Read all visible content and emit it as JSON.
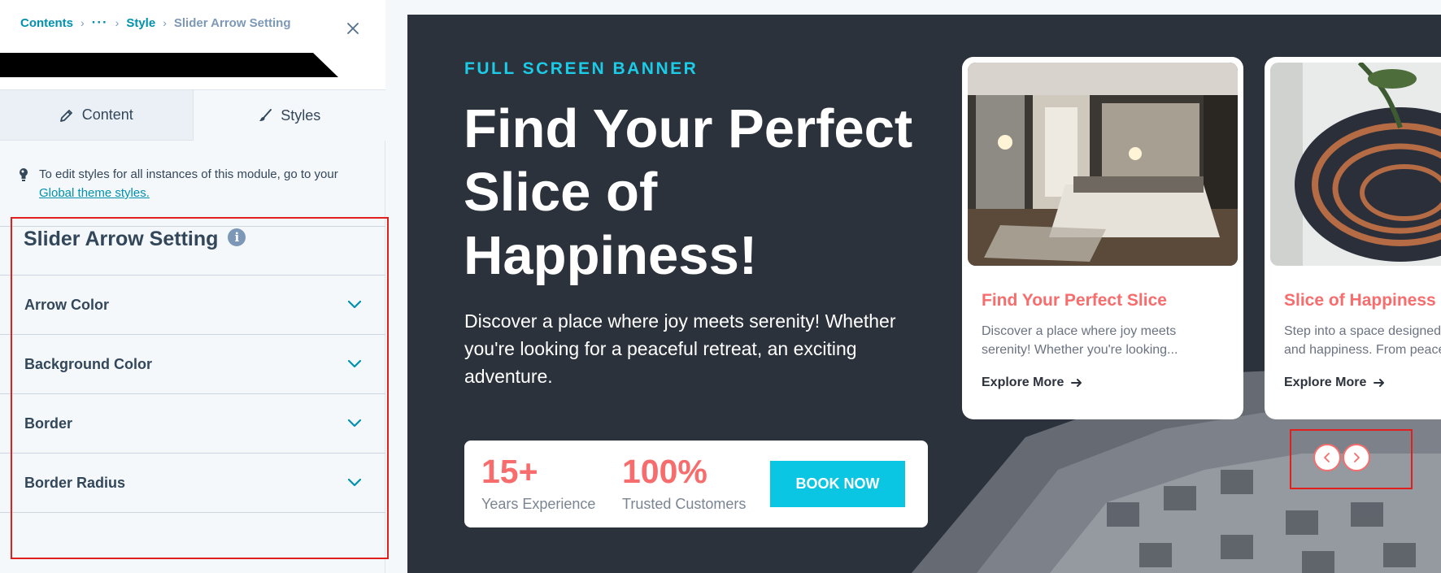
{
  "breadcrumb": {
    "root": "Contents",
    "ellipsis": "···",
    "parent": "Style",
    "current": "Slider Arrow Setting"
  },
  "tabs": [
    {
      "label": "Content",
      "icon": "pencil-icon",
      "active": false
    },
    {
      "label": "Styles",
      "icon": "brush-icon",
      "active": true
    }
  ],
  "note": {
    "text": "To edit styles for all instances of this module, go to your ",
    "link": "Global theme styles."
  },
  "section": {
    "title": "Slider Arrow Setting",
    "info_icon": "info-icon",
    "items": [
      {
        "label": "Arrow Color"
      },
      {
        "label": "Background Color"
      },
      {
        "label": "Border"
      },
      {
        "label": "Border Radius"
      }
    ]
  },
  "preview": {
    "kicker": "FULL SCREEN BANNER",
    "headline": "Find Your Perfect Slice of Happiness!",
    "lead": "Discover a place where joy meets serenity! Whether you're looking for a peaceful retreat, an exciting adventure.",
    "stats": [
      {
        "value": "15+",
        "label": "Years Experience"
      },
      {
        "value": "100%",
        "label": "Trusted Customers"
      }
    ],
    "cta": "BOOK NOW",
    "cards": [
      {
        "title": "Find Your Perfect Slice",
        "desc": "Discover a place where joy meets serenity! Whether you're looking...",
        "link": "Explore More"
      },
      {
        "title": "Slice of Happiness",
        "desc": "Step into a space designed for comfort and happiness. From peace",
        "link": "Explore More"
      }
    ]
  },
  "colors": {
    "accent_teal": "#0091ae",
    "kicker_cyan": "#1ccbe6",
    "coral": "#f76c6c",
    "dark_bg": "#2c323c",
    "highlight_red": "#e0201e"
  }
}
